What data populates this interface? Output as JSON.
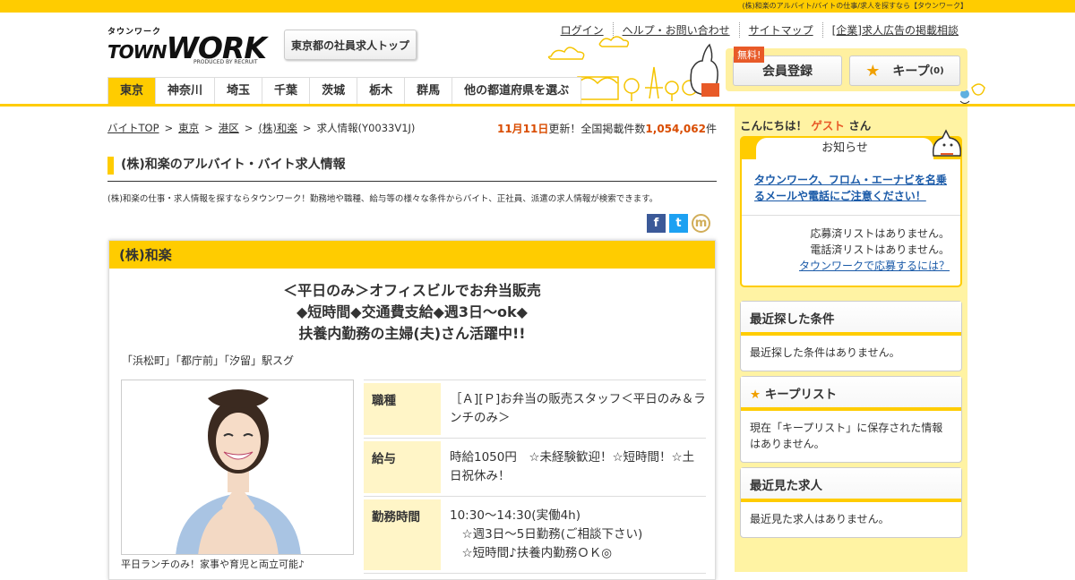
{
  "header": {
    "tagline": "(株)和楽のアルバイト/バイトの仕事/求人を探すなら【タウンワーク】",
    "logo_kana": "タウンワーク",
    "logo_word": "TOWNWORK",
    "logo_town": "TOWN",
    "logo_work": "WORK",
    "logo_sub": "PRODUCED BY RECRUIT",
    "tokyo_top_label": "東京都の社員求人トップ",
    "links": [
      "ログイン",
      "ヘルプ・お問い合わせ",
      "サイトマップ",
      "[企業]求人広告の掲載相談"
    ],
    "register_label": "会員登録",
    "free_badge": "無料!",
    "keep_label": "キープ",
    "keep_count": "(0)"
  },
  "nav": {
    "items": [
      "東京",
      "神奈川",
      "埼玉",
      "千葉",
      "茨城",
      "栃木",
      "群馬",
      "他の都道府県を選ぶ"
    ]
  },
  "breadcrumb": {
    "items": [
      "バイトTOP",
      "東京",
      "港区",
      "(株)和楽"
    ],
    "current": "求人情報(Y0033V1J)",
    "separator": ">"
  },
  "update": {
    "date": "11月11日",
    "text1": "更新！全国掲載件数",
    "count": "1,054,062",
    "unit": "件"
  },
  "page": {
    "title": "(株)和楽のアルバイト・バイト求人情報",
    "description": "(株)和楽の仕事・求人情報を探すならタウンワーク！勤務地や職種、給与等の様々な条件からバイト、正社員、派遣の求人情報が検索できます。"
  },
  "social": [
    {
      "name": "facebook-icon",
      "glyph": "f",
      "color": "#3b5998"
    },
    {
      "name": "twitter-icon",
      "glyph": "t",
      "color": "#1da1f2"
    },
    {
      "name": "mixi-icon",
      "glyph": "m",
      "color": "#d1ad59"
    }
  ],
  "job": {
    "company": "(株)和楽",
    "catch_lines": [
      "＜平日のみ＞オフィスビルでお弁当販売",
      "◆短時間◆交通費支給◆週3日～ok◆",
      "扶養内勤務の主婦(夫)さん活躍中!!"
    ],
    "station": "「浜松町」「都庁前」「汐留」駅スグ",
    "photo_caption": "平日ランチのみ！家事や育児と両立可能♪",
    "info": [
      {
        "key": "職種",
        "value": "［Ａ][Ｐ]お弁当の販売スタッフ＜平日のみ＆ランチのみ＞"
      },
      {
        "key": "給与",
        "value": "時給1050円　☆未経験歓迎！☆短時間！☆土日祝休み！"
      },
      {
        "key": "勤務時間",
        "value": "10:30～14:30(実働4h)\n　☆週3日～5日勤務(ご相談下さい)\n　☆短時間♪扶養内勤務ＯＫ◎"
      }
    ]
  },
  "sidebar": {
    "hello_prefix": "こんにちは！",
    "hello_name": "ゲスト",
    "hello_suffix": "さん",
    "notice_title": "お知らせ",
    "notice_link": "タウンワーク、フロム・エーナビを名乗るメールや電話にご注意ください！",
    "applied_status": "応募済リストはありません。",
    "called_status": "電話済リストはありません。",
    "how_to_link": "タウンワークで応募するには？",
    "recent_conditions_title": "最近探した条件",
    "recent_conditions_body": "最近探した条件はありません。",
    "keep_list_title": "キープリスト",
    "keep_list_body": "現在「キープリスト」に保存された情報はありません。",
    "recent_jobs_title": "最近見た求人",
    "recent_jobs_body": "最近見た求人はありません。"
  },
  "colors": {
    "accent": "#ffcc00",
    "orange": "#e85a28",
    "link_blue": "#1a5aa8",
    "sidebar_bg": "#fff3a3",
    "cell_bg": "#fff5c7"
  }
}
